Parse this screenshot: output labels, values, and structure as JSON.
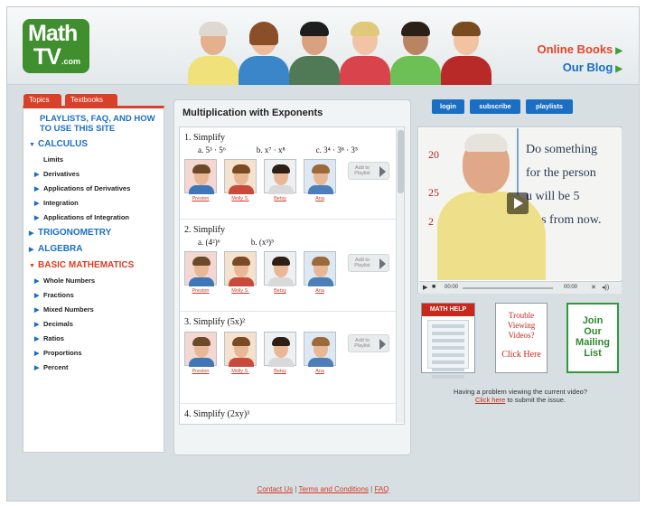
{
  "header": {
    "logo_line1": "Math",
    "logo_line2": "TV",
    "logo_suffix": ".com",
    "links": [
      "Online Books",
      "Our Blog"
    ]
  },
  "sidebar": {
    "tabs": [
      "Topics",
      "Textbooks"
    ],
    "intro_link": "PLAYLISTS, FAQ, AND HOW TO USE THIS SITE",
    "calculus": {
      "label": "CALCULUS",
      "items": [
        "Limits",
        "Derivatives",
        "Applications of Derivatives",
        "Integration",
        "Applications of Integration"
      ]
    },
    "trigonometry": "TRIGONOMETRY",
    "algebra": "ALGEBRA",
    "basic": {
      "label": "BASIC MATHEMATICS",
      "items": [
        "Whole Numbers",
        "Fractions",
        "Mixed Numbers",
        "Decimals",
        "Ratios",
        "Proportions",
        "Percent"
      ]
    }
  },
  "center": {
    "title": "Multiplication with Exponents",
    "add_to_playlist": "Add to Playlist",
    "instructors": [
      "Preston",
      "Molly S.",
      "Betsy",
      "Ana"
    ],
    "problems": [
      {
        "title": "1. Simplify",
        "parts": [
          "a. 5³ · 5⁶",
          "b. x⁷ · x⁸",
          "c. 3⁴ · 3⁸ · 3⁵"
        ]
      },
      {
        "title": "2. Simplify",
        "parts": [
          "a. (4²)⁶",
          "b. (x³)⁵"
        ]
      },
      {
        "title": "3. Simplify (5x)²",
        "parts": []
      },
      {
        "title": "4. Simplify (2xy)³",
        "parts": []
      }
    ]
  },
  "right": {
    "buttons": [
      "login",
      "subscribe",
      "playlists"
    ],
    "whiteboard": [
      "Do something",
      "for the person",
      "u will be 5",
      "ears from now."
    ],
    "board_numbers": [
      "20",
      "25",
      "2"
    ],
    "player": {
      "time_current": "00:00",
      "time_total": "00:00"
    },
    "math_help": "MATH HELP",
    "trouble": [
      "Trouble",
      "Viewing",
      "Videos?"
    ],
    "click_here": "Click Here",
    "mailing": [
      "Join",
      "Our",
      "Mailing",
      "List"
    ],
    "problem_text": "Having a problem viewing the current video?",
    "problem_link": "Click here",
    "problem_tail": "to submit the issue."
  },
  "footer": {
    "links": [
      "Contact Us",
      "Terms and Conditions",
      "FAQ"
    ]
  },
  "colors": {
    "brand_green": "#3f8f2e",
    "accent_red": "#d8402a",
    "link_blue": "#1a6fc4"
  }
}
